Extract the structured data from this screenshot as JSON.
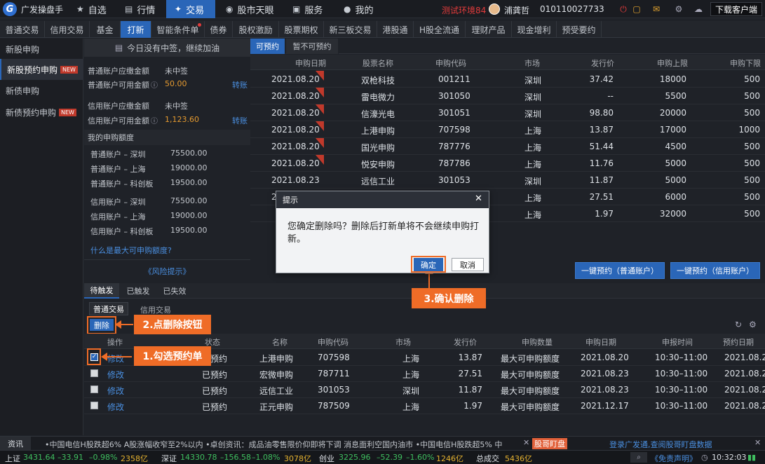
{
  "topbar": {
    "app_name": "广发操盘手",
    "nav": [
      {
        "icon": "star-icon",
        "label": "自选"
      },
      {
        "icon": "chart-icon",
        "label": "行情"
      },
      {
        "icon": "trade-icon",
        "label": "交易"
      },
      {
        "icon": "eye-icon",
        "label": "股市天眼"
      },
      {
        "icon": "briefcase-icon",
        "label": "服务"
      },
      {
        "icon": "user-icon",
        "label": "我的"
      }
    ],
    "env": "测试环境84",
    "username": "浦龚哲",
    "account": "010110027733",
    "download": "下载客户端"
  },
  "subnav": [
    "普通交易",
    "信用交易",
    "基金",
    "打新",
    "智能条件单",
    "债券",
    "股权激励",
    "股票期权",
    "新三板交易",
    "港股通",
    "H股全流通",
    "理财产品",
    "现金增利",
    "预受要约"
  ],
  "sidebar": [
    {
      "label": "新股申购",
      "new": ""
    },
    {
      "label": "新股预约申购",
      "new": "NEW"
    },
    {
      "label": "新债申购",
      "new": ""
    },
    {
      "label": "新债预约申购",
      "new": "NEW"
    }
  ],
  "info": {
    "nowin": "今日没有中签，继续加油",
    "normal_due_label": "普通账户应缴金额",
    "normal_due": "未中签",
    "normal_avail_label": "普通账户可用金额",
    "normal_avail": "50.00",
    "transfer": "转账",
    "credit_due_label": "信用账户应缴金额",
    "credit_due": "未中签",
    "credit_avail_label": "信用账户可用金额",
    "credit_avail": "1,123.60",
    "quota_title": "我的申购额度",
    "quotas": [
      {
        "label": "普通账户 – 深圳",
        "value": "75500.00"
      },
      {
        "label": "普通账户 – 上海",
        "value": "19000.00"
      },
      {
        "label": "普通账户 – 科创板",
        "value": "19500.00"
      },
      {
        "label": "信用账户 – 深圳",
        "value": "75500.00"
      },
      {
        "label": "信用账户 – 上海",
        "value": "19000.00"
      },
      {
        "label": "信用账户 – 科创板",
        "value": "19500.00"
      }
    ],
    "max_link": "什么是最大可申购额度?",
    "risk": "《风险提示》"
  },
  "top_table": {
    "tabs": [
      "可预约",
      "暂不可预约"
    ],
    "headers": [
      "申购日期",
      "股票名称",
      "申购代码",
      "市场",
      "发行价",
      "申购上限",
      "申购下限"
    ],
    "rows": [
      [
        "2021.08.20",
        "双枪科技",
        "001211",
        "深圳",
        "37.42",
        "18000",
        "500"
      ],
      [
        "2021.08.20",
        "雷电微力",
        "301050",
        "深圳",
        "--",
        "5500",
        "500"
      ],
      [
        "2021.08.20",
        "信濠光电",
        "301051",
        "深圳",
        "98.80",
        "20000",
        "500"
      ],
      [
        "2021.08.20",
        "上港申购",
        "707598",
        "上海",
        "13.87",
        "17000",
        "1000"
      ],
      [
        "2021.08.20",
        "国光申购",
        "787776",
        "上海",
        "51.44",
        "4500",
        "500"
      ],
      [
        "2021.08.20",
        "悦安申购",
        "787786",
        "上海",
        "11.76",
        "5000",
        "500"
      ],
      [
        "2021.08.23",
        "远信工业",
        "301053",
        "深圳",
        "11.87",
        "5000",
        "500"
      ],
      [
        "2",
        "",
        "",
        "上海",
        "27.51",
        "6000",
        "500"
      ],
      [
        "",
        "",
        "",
        "上海",
        "1.97",
        "32000",
        "500"
      ]
    ],
    "btn_normal": "一键预约（普通账户）",
    "btn_credit": "一键预约（信用账户）"
  },
  "bottom": {
    "tabs": [
      "待触发",
      "已触发",
      "已失效"
    ],
    "subtabs": [
      "普通交易",
      "信用交易"
    ],
    "delete": "删除",
    "headers": [
      "操作",
      "状态",
      "名称",
      "申购代码",
      "市场",
      "发行价",
      "申购数量",
      "申购日期",
      "申报时间",
      "预约日期"
    ],
    "rows": [
      [
        "修改",
        "已预约",
        "上港申购",
        "707598",
        "上海",
        "13.87",
        "最大可申购额度",
        "2021.08.20",
        "10:30–11:00",
        "2021.08.20"
      ],
      [
        "修改",
        "已预约",
        "宏微申购",
        "787711",
        "上海",
        "27.51",
        "最大可申购额度",
        "2021.08.23",
        "10:30–11:00",
        "2021.08.20"
      ],
      [
        "修改",
        "已预约",
        "远信工业",
        "301053",
        "深圳",
        "11.87",
        "最大可申购额度",
        "2021.08.23",
        "10:30–11:00",
        "2021.08.20"
      ],
      [
        "修改",
        "已预约",
        "正元申购",
        "787509",
        "上海",
        "1.97",
        "最大可申购额度",
        "2021.12.17",
        "10:30–11:00",
        "2021.08.20"
      ]
    ]
  },
  "annotations": {
    "step1": "1.勾选预约单",
    "step2": "2.点删除按钮",
    "step3": "3.确认删除"
  },
  "dialog": {
    "title": "提示",
    "message": "您确定删除吗？删除后打新单将不会继续申购打新。",
    "ok": "确定",
    "cancel": "取消"
  },
  "ticker": {
    "label": "资讯",
    "text": "•中国电信H股跌超6% A股涨幅收窄至2%以内   •卓创资讯：成品油零售限价仰即将下调 消息面利空国内油市   •中国电信H股跌超5% 中",
    "tag": "股哥盯盘",
    "promo": "登录广发通,查阅股哥盯盘数据"
  },
  "status": {
    "sh_label": "上证",
    "sh_val": "3431.64",
    "sh_chg": "–33.91",
    "sh_pct": "–0.98%",
    "sh_amt": "2358亿",
    "sz_label": "深证",
    "sz_val": "14330.78",
    "sz_chg": "–156.58",
    "sz_pct": "–1.08%",
    "sz_amt": "3078亿",
    "cy_label": "创业",
    "cy_val": "3225.96",
    "cy_chg": "–52.39",
    "cy_pct": "–1.60%",
    "cy_amt": "1246亿",
    "total_label": "总成交",
    "total": "5436亿",
    "disclaimer": "《免责声明》",
    "time": "10:32:03"
  }
}
